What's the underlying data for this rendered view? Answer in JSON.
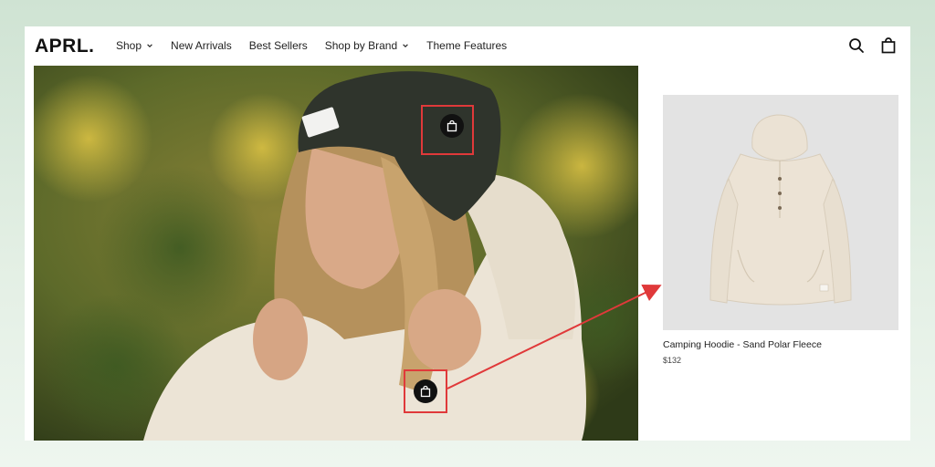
{
  "brand": {
    "logo": "APRL."
  },
  "nav": {
    "items": [
      {
        "label": "Shop",
        "has_dropdown": true
      },
      {
        "label": "New Arrivals",
        "has_dropdown": false
      },
      {
        "label": "Best Sellers",
        "has_dropdown": false
      },
      {
        "label": "Shop by Brand",
        "has_dropdown": true
      },
      {
        "label": "Theme Features",
        "has_dropdown": false
      }
    ]
  },
  "header_icons": [
    "search-icon",
    "cart-icon"
  ],
  "hero": {
    "hotspots": [
      {
        "icon": "shopping-bag-icon",
        "highlighted": true
      },
      {
        "icon": "shopping-bag-icon",
        "highlighted": true
      }
    ]
  },
  "product": {
    "name": "Camping Hoodie - Sand Polar Fleece",
    "price": "$132"
  },
  "colors": {
    "highlight": "#e0393a",
    "hotspot": "#111111",
    "fleece": "#ece4d6",
    "beanie": "#2f342c"
  }
}
